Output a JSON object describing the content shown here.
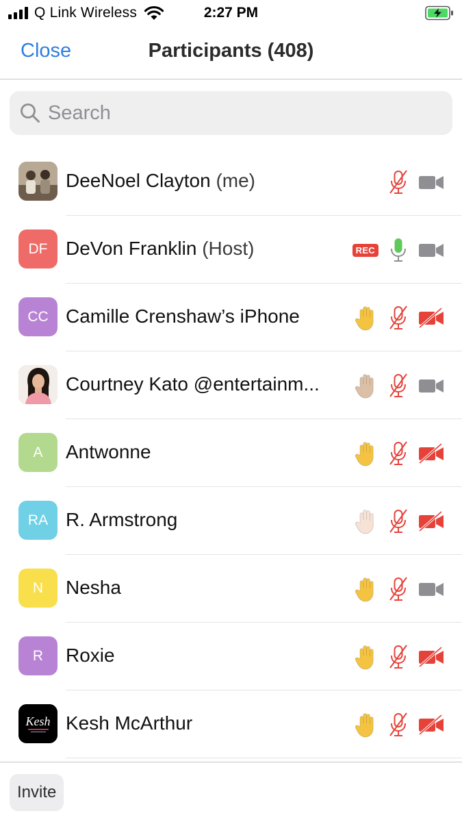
{
  "status_bar": {
    "carrier": "Q Link Wireless",
    "time": "2:27 PM"
  },
  "nav": {
    "close_label": "Close",
    "title": "Participants (408)"
  },
  "search": {
    "placeholder": "Search"
  },
  "participants": [
    {
      "name": "DeeNoel Clayton",
      "role": "(me)",
      "avatar_type": "photo",
      "initials": "",
      "avatar_color": "#8a7a68",
      "rec": false,
      "hand": "none",
      "mic": "muted",
      "video": "on"
    },
    {
      "name": "DeVon Franklin",
      "role": "(Host)",
      "avatar_type": "initials",
      "initials": "DF",
      "avatar_color": "#ef6b67",
      "rec": true,
      "rec_label": "REC",
      "hand": "none",
      "mic": "unmuted",
      "video": "on"
    },
    {
      "name": "Camille Crenshaw’s iPhone",
      "role": "",
      "avatar_type": "initials",
      "initials": "CC",
      "avatar_color": "#b883d4",
      "rec": false,
      "hand": "#f4c342",
      "mic": "muted",
      "video": "off"
    },
    {
      "name": "Courtney Kato @entertainm...",
      "role": "",
      "avatar_type": "photo",
      "initials": "",
      "avatar_color": "#e1a7a3",
      "rec": false,
      "hand": "#dbbfa6",
      "mic": "muted",
      "video": "on"
    },
    {
      "name": "Antwonne",
      "role": "",
      "avatar_type": "initials",
      "initials": "A",
      "avatar_color": "#b2d98e",
      "rec": false,
      "hand": "#f4c342",
      "mic": "muted",
      "video": "off"
    },
    {
      "name": "R. Armstrong",
      "role": "",
      "avatar_type": "initials",
      "initials": "RA",
      "avatar_color": "#6fd0e6",
      "rec": false,
      "hand": "#f6e2d6",
      "mic": "muted",
      "video": "off"
    },
    {
      "name": "Nesha",
      "role": "",
      "avatar_type": "initials",
      "initials": "N",
      "avatar_color": "#f8df4b",
      "rec": false,
      "hand": "#f4c342",
      "mic": "muted",
      "video": "on"
    },
    {
      "name": "Roxie",
      "role": "",
      "avatar_type": "initials",
      "initials": "R",
      "avatar_color": "#b883d4",
      "rec": false,
      "hand": "#f4c342",
      "mic": "muted",
      "video": "off"
    },
    {
      "name": "Kesh McArthur",
      "role": "",
      "avatar_type": "logo",
      "initials": "",
      "avatar_color": "#000000",
      "rec": false,
      "hand": "#f4c342",
      "mic": "muted",
      "video": "off"
    }
  ],
  "bottom": {
    "invite_label": "Invite"
  },
  "colors": {
    "accent": "#2d7ee0",
    "muted_red": "#e5433a",
    "mic_green": "#5fc95b",
    "video_gray": "#8e8e93"
  }
}
